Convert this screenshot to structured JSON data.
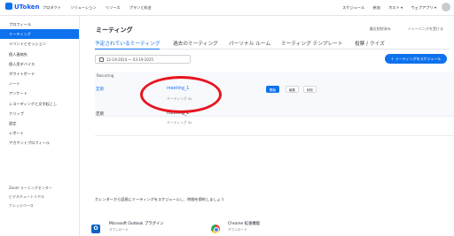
{
  "header": {
    "logo": "UToken",
    "nav_left": [
      "プロダクト",
      "ソリューション",
      "リソース",
      "プランと料金"
    ],
    "nav_right": [
      "スケジュール",
      "参加",
      "ホスト ▾",
      "ウェブアプリ ▾"
    ]
  },
  "sidebar": {
    "items": [
      {
        "label": "プロフィール"
      },
      {
        "label": "ミーティング"
      },
      {
        "label": "イベントとセッション"
      },
      {
        "label": "個人連絡先"
      },
      {
        "label": "個人用デバイス"
      },
      {
        "label": "ホワイトボード"
      },
      {
        "label": "ノート"
      },
      {
        "label": "アンケート"
      },
      {
        "label": "レコーディングと文字起こし"
      },
      {
        "label": "クリップ"
      },
      {
        "label": "設定"
      },
      {
        "label": "レポート"
      },
      {
        "label": "アカウントプロフィール"
      }
    ],
    "footer": [
      "Zoom ラーニングセンター",
      "ビデオチュートリアル",
      "ナレッジベース"
    ]
  },
  "main": {
    "title": "ミーティング",
    "top_links": [
      "最近削除済み",
      "トレーニングを受ける"
    ],
    "tabs": [
      {
        "label": "予定されているミーティング"
      },
      {
        "label": "過去のミーティング"
      },
      {
        "label": "パーソナル ルーム"
      },
      {
        "label": "ミーティング テンプレート"
      },
      {
        "label": "投票 / クイズ"
      }
    ],
    "date_range": "12-19-2024  ～  03-19-2025",
    "schedule_button": "＋ ミーティングをスケジュール",
    "recurring_label": "Recurring",
    "meetings": [
      {
        "row_label": "定期",
        "name": "meeting_1",
        "id": "ミーティング ID:",
        "actions": [
          "開始",
          "編集",
          "削除"
        ]
      },
      {
        "row_label": "定期",
        "name": "meeting_2",
        "id": "ミーティング ID:"
      }
    ],
    "promo": "カレンダーから容易にミーティングをスケジュールし、時間を節約しましょう",
    "apps": [
      {
        "name": "Microsoft Outlook プラグイン",
        "action": "ダウンロード"
      },
      {
        "name": "Chrome 拡張機能",
        "action": "ダウンロード"
      }
    ]
  },
  "colors": {
    "accent": "#0e72ed",
    "highlight": "#e8141e"
  }
}
